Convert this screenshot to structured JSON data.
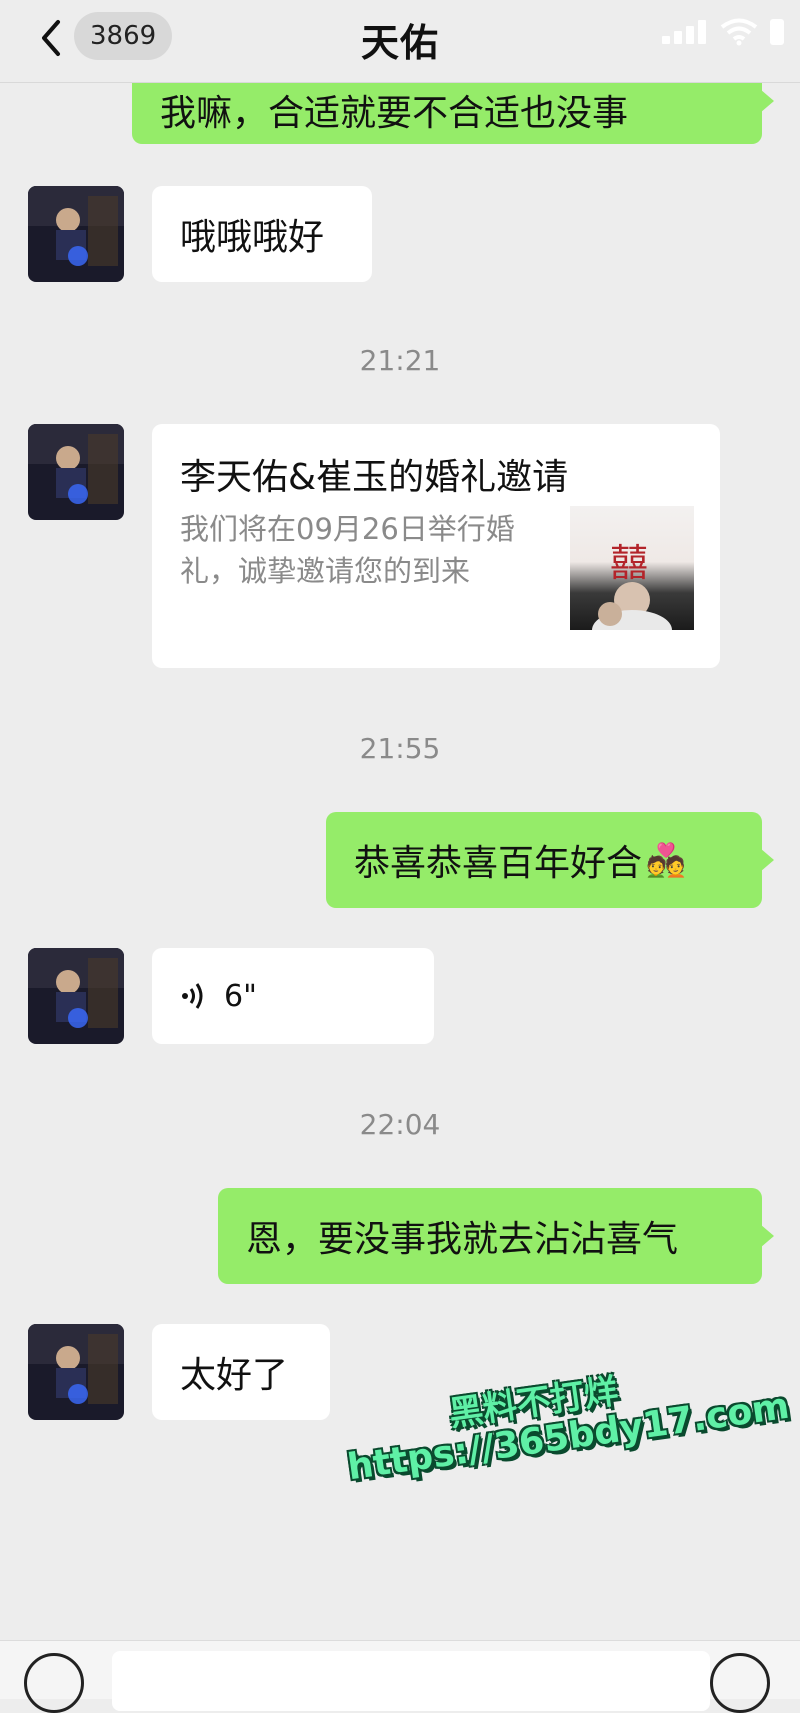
{
  "header": {
    "title": "天佑",
    "unread_count": "3869"
  },
  "messages": {
    "m0": "我嘛，合适就要不合适也没事",
    "m1": "哦哦哦好",
    "t1": "21:21",
    "card": {
      "title": "李天佑&崔玉的婚礼邀请",
      "description": "我们将在09月26日举行婚礼，诚挚邀请您的到来",
      "thumb_char": "囍"
    },
    "t2": "21:55",
    "m2": "恭喜恭喜百年好合",
    "m2_emoji": "💑",
    "voice_duration": "6\"",
    "t3": "22:04",
    "m3": "恩，要没事我就去沾沾喜气",
    "m4": "太好了"
  },
  "watermark": {
    "line1": "黑料不打烊",
    "line2": "https://365bdy17.com"
  },
  "colors": {
    "self_bubble": "#95ec69",
    "other_bubble": "#ffffff",
    "background": "#ededed",
    "watermark": "#5ff0a6"
  }
}
